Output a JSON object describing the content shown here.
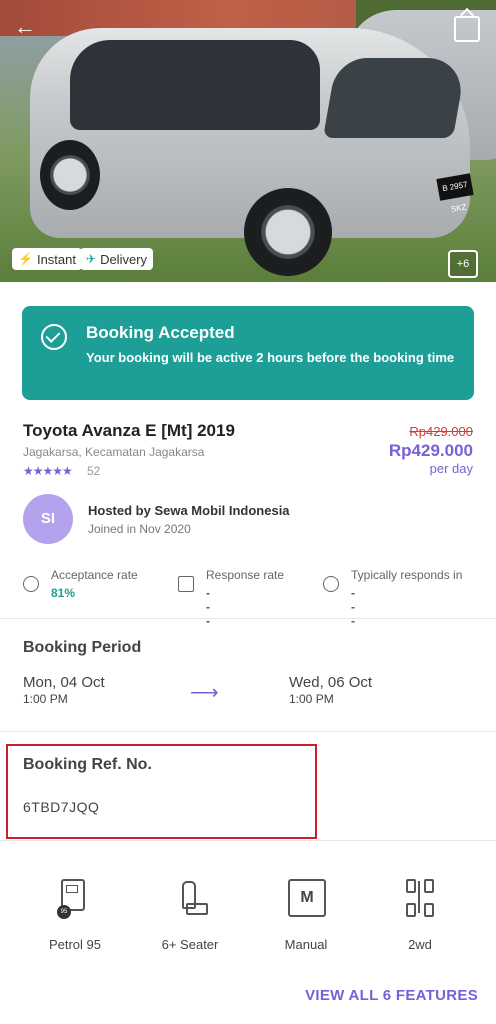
{
  "hero": {
    "plate_text": "B 2957 SKZ",
    "tags": {
      "instant": "Instant",
      "delivery": "Delivery"
    },
    "more_photos": "+6"
  },
  "banner": {
    "title": "Booking Accepted",
    "message": "Your booking will be active 2 hours before the booking time",
    "color": "#1d9e96"
  },
  "car": {
    "name": "Toyota Avanza E [Mt] 2019",
    "location": "Jagakarsa, Kecamatan Jagakarsa",
    "stars": "★★★★★",
    "rating_count": "52",
    "price_old": "Rp429.000",
    "price_new": "Rp429.000",
    "price_unit": "per day"
  },
  "host": {
    "initials": "SI",
    "name": "Hosted by Sewa Mobil  Indonesia",
    "joined": "Joined in Nov 2020",
    "stats": [
      {
        "label": "Acceptance rate",
        "value": "81%"
      },
      {
        "label": "Response rate",
        "value": "---"
      },
      {
        "label": "Typically responds in",
        "value": "---"
      }
    ]
  },
  "booking_period": {
    "title": "Booking Period",
    "start_date": "Mon, 04 Oct",
    "start_time": "1:00 PM",
    "end_date": "Wed, 06 Oct",
    "end_time": "1:00 PM"
  },
  "booking_ref": {
    "title": "Booking Ref. No.",
    "value": "6TBD7JQQ"
  },
  "features": {
    "items": [
      {
        "label": "Petrol 95",
        "badge": "95"
      },
      {
        "label": "6+ Seater"
      },
      {
        "label": "Manual",
        "icon_text": "M"
      },
      {
        "label": "2wd"
      }
    ],
    "view_all": "VIEW ALL 6 FEATURES"
  },
  "accent_color": "#7a5fd8"
}
